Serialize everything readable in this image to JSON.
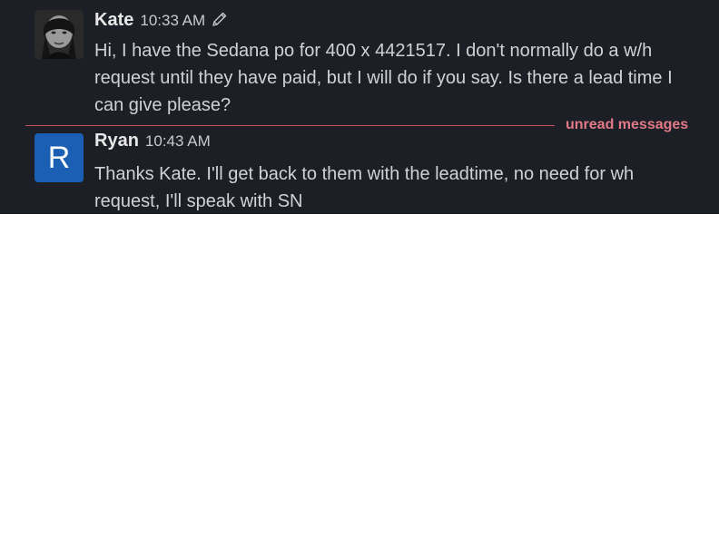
{
  "messages": [
    {
      "sender": "Kate",
      "time": "10:33 AM",
      "edited_icon": "pencil-icon",
      "avatar": "photo",
      "text": "Hi, I have the Sedana po for 400 x 4421517. I don't normally do a w/h request until they have paid, but I will do if you say. Is there a lead time I can give please?"
    },
    {
      "sender": "Ryan",
      "time": "10:43 AM",
      "avatar_initial": "R",
      "avatar_color": "#1a5fb4",
      "text": "Thanks Kate. I'll get back to them with the leadtime, no need for wh request, I'll speak with SN"
    }
  ],
  "divider": {
    "label": "unread messages",
    "color": "#c9505c"
  },
  "theme": {
    "background": "#1d1f27",
    "text": "#d1d2d3"
  }
}
